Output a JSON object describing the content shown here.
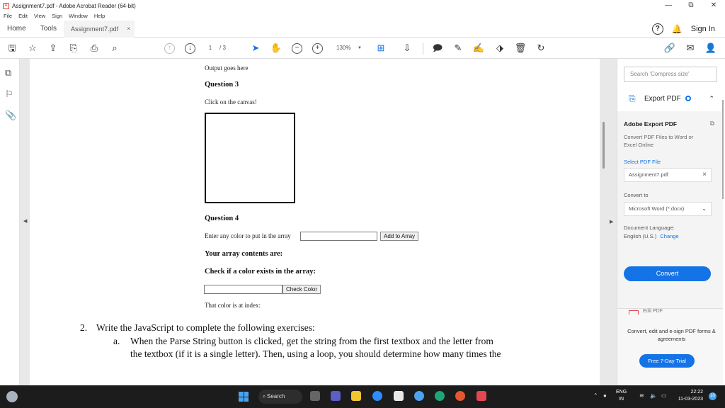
{
  "window": {
    "title": "Assignment7.pdf - Adobe Acrobat Reader (64-bit)",
    "controls": {
      "minimize": "—",
      "maximize": "⧉",
      "close": "✕"
    }
  },
  "menu": [
    "File",
    "Edit",
    "View",
    "Sign",
    "Window",
    "Help"
  ],
  "tabs": {
    "home": "Home",
    "tools": "Tools",
    "document": "Assignment7.pdf",
    "close": "×"
  },
  "header_right": {
    "help": "?",
    "sign_in": "Sign In"
  },
  "toolbar": {
    "page_current": "1",
    "page_total": "/ 3",
    "zoom": "130%"
  },
  "document": {
    "output_text": "Output goes here",
    "question3_heading": "Question 3",
    "question3_instruction": "Click on the canvas!",
    "question4_heading": "Question 4",
    "question4_prompt": "Enter any color to put in the array",
    "add_button": "Add to Array",
    "array_contents": "Your array contents are:",
    "check_heading": "Check if a color exists in the array:",
    "check_button": "Check Color",
    "index_text": "That color is at index:",
    "item2_number": "2.",
    "item2_text": "Write the JavaScript to complete the following exercises:",
    "item2a_letter": "a.",
    "item2a_line1": "When the Parse String button is clicked, get the string from the first textbox and the letter from",
    "item2a_line2": "the textbox (if it is a single letter). Then, using a loop, you should determine how many times the"
  },
  "right_panel": {
    "search_placeholder": "Search 'Compress size'",
    "export_label": "Export PDF",
    "card_title": "Adobe Export PDF",
    "card_desc": "Convert PDF Files to Word or Excel Online",
    "select_file_label": "Select PDF File",
    "selected_file": "Assignment7.pdf",
    "convert_to_label": "Convert to",
    "convert_to_value": "Microsoft Word (*.docx)",
    "doc_lang_label": "Document Language:",
    "doc_lang_value": "English (U.S.)",
    "doc_lang_change": "Change",
    "convert_button": "Convert",
    "edit_pdf_label": "Edit PDF",
    "promo_text": "Convert, edit and e-sign PDF forms & agreements",
    "trial_button": "Free 7-Day Trial"
  },
  "taskbar": {
    "search_label": "Search",
    "lang_line1": "ENG",
    "lang_line2": "IN",
    "time": "22:22",
    "date": "11-03-2023",
    "notifications": "10"
  },
  "colors": {
    "accent": "#1473e6",
    "acrobat_red": "#e34850",
    "taskbar": "#1c1c1c"
  }
}
